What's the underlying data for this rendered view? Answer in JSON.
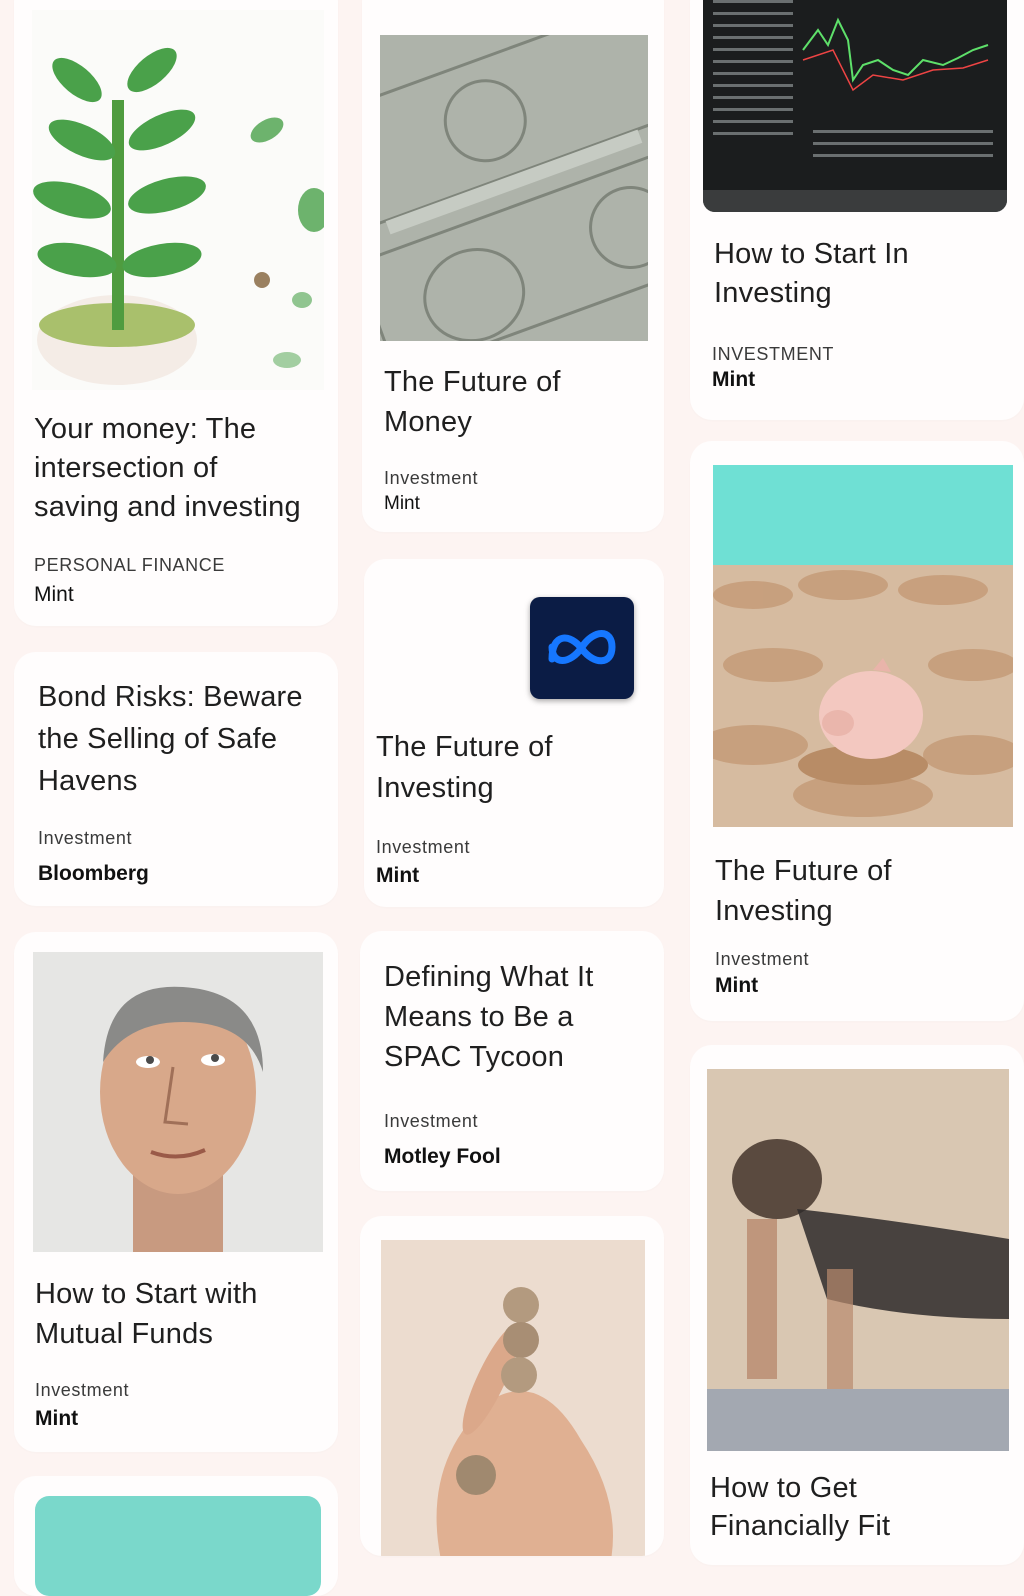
{
  "cards": [
    {
      "title_lines": [
        "Your money: The",
        "intersection of",
        "saving and investing"
      ],
      "category": "PERSONAL FINANCE",
      "source": "Mint",
      "image": "succulent-plant-photo"
    },
    {
      "title_lines": [
        "Bond Risks: Beware",
        "the Selling of Safe",
        "Havens"
      ],
      "category": "Investment",
      "source": "Bloomberg"
    },
    {
      "title_lines": [
        "How to Start with",
        "Mutual Funds"
      ],
      "category": "Investment",
      "source": "Mint",
      "image": "man-looking-up-photo"
    },
    {
      "title_lines": [
        "The Future of",
        "Money"
      ],
      "category": "Investment",
      "source": "Mint",
      "image": "dollar-bills-photo"
    },
    {
      "title_lines": [
        "The Future of",
        "Investing"
      ],
      "category": "Investment",
      "source": "Mint",
      "image": "meta-logo-icon"
    },
    {
      "title_lines": [
        "Defining What It",
        "Means to Be a",
        "SPAC Tycoon"
      ],
      "category": "Investment",
      "source": "Motley Fool"
    },
    {
      "title_lines": [
        "How to Start In",
        "Investing"
      ],
      "category": "INVESTMENT",
      "source": "Mint",
      "image": "stock-chart-monitor-photo"
    },
    {
      "title_lines": [
        "The Future of",
        "Investing"
      ],
      "category": "Investment",
      "source": "Mint",
      "image": "piggy-bank-coins-photo"
    },
    {
      "title_lines": [
        "How to Get",
        "Financially Fit"
      ],
      "image": "workout-photo"
    }
  ],
  "colors": {
    "background": "#fdf4f2",
    "card": "#fffdfd",
    "teal": "#6fe0d4"
  }
}
